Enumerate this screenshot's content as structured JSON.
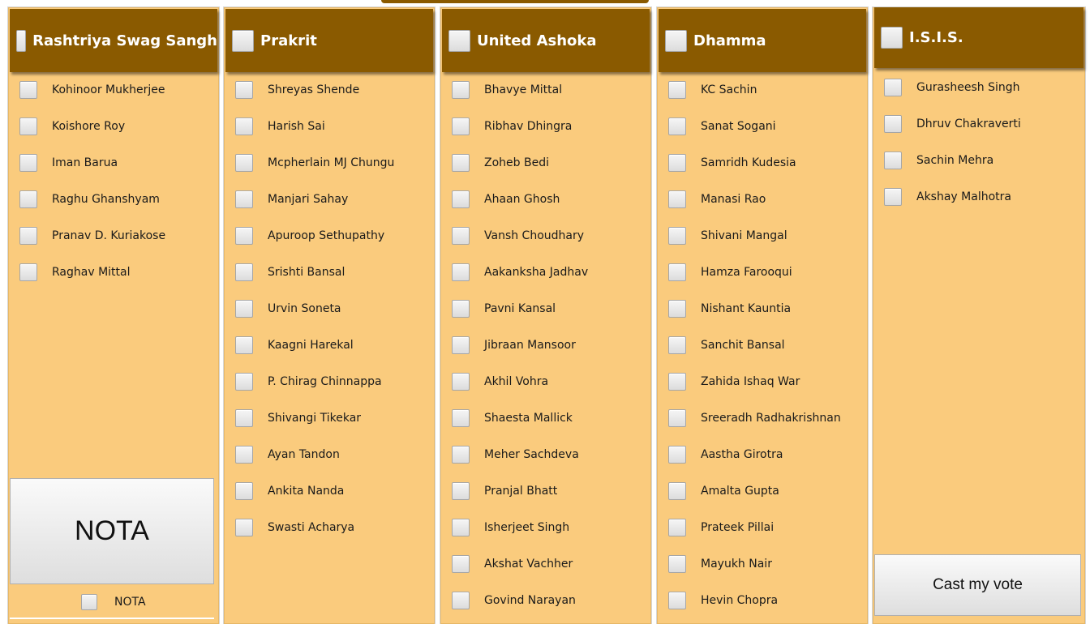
{
  "parties": [
    {
      "name": "Rashtriya Swag Sangh",
      "candidates": [
        "Kohinoor Mukherjee",
        "Koishore Roy",
        "Iman Barua",
        "Raghu Ghanshyam",
        "Pranav D. Kuriakose",
        "Raghav Mittal"
      ]
    },
    {
      "name": "Prakrit",
      "candidates": [
        "Shreyas Shende",
        "Harish Sai",
        "Mcpherlain MJ Chungu",
        "Manjari Sahay",
        "Apuroop Sethupathy",
        "Srishti Bansal",
        "Urvin Soneta",
        "Kaagni Harekal",
        "P. Chirag Chinnappa",
        "Shivangi Tikekar",
        "Ayan Tandon",
        "Ankita Nanda",
        "Swasti Acharya"
      ]
    },
    {
      "name": "United Ashoka",
      "candidates": [
        "Bhavye Mittal",
        "Ribhav Dhingra",
        "Zoheb Bedi",
        "Ahaan Ghosh",
        "Vansh Choudhary",
        "Aakanksha Jadhav",
        "Pavni Kansal",
        "Jibraan Mansoor",
        "Akhil Vohra",
        "Shaesta Mallick",
        "Meher Sachdeva",
        "Pranjal Bhatt",
        "Isherjeet Singh",
        "Akshat Vachher",
        "Govind Narayan"
      ]
    },
    {
      "name": "Dhamma",
      "candidates": [
        "KC Sachin",
        "Sanat Sogani",
        "Samridh Kudesia",
        "Manasi Rao",
        "Shivani Mangal",
        "Hamza Farooqui",
        "Nishant Kauntia",
        "Sanchit Bansal",
        "Zahida Ishaq War",
        "Sreeradh Radhakrishnan",
        "Aastha Girotra",
        "Amalta Gupta",
        "Prateek Pillai",
        "Mayukh Nair",
        "Hevin Chopra"
      ]
    },
    {
      "name": "I.S.I.S.",
      "candidates": [
        "Gurasheesh Singh",
        "Dhruv Chakraverti",
        "Sachin Mehra",
        "Akshay Malhotra"
      ]
    }
  ],
  "nota": {
    "button_label": "NOTA",
    "checkbox_label": "NOTA"
  },
  "cast_button_label": "Cast my vote",
  "colors": {
    "header": "#8a5a00",
    "panel": "#facb7d"
  }
}
